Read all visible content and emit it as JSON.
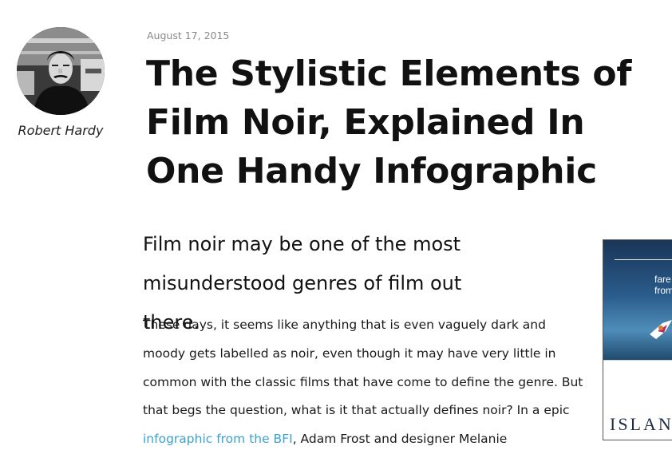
{
  "author": {
    "name": "Robert Hardy"
  },
  "article": {
    "date": "August 17, 2015",
    "title": "The Stylistic Elements of Film Noir, Explained In One Handy Infographic",
    "lead": "Film noir may be one of the most misunderstood genres of film out there.",
    "body_before_link": "These days, it seems like anything that is even vaguely dark and moody gets labelled as noir, even though it may have very little in common with the classic films that have come to define the genre. But that begs the question, what is it that actually defines noir? In a epic ",
    "link_text": "infographic from the BFI",
    "body_after_link": ", Adam Frost and designer Melanie"
  },
  "ad": {
    "copy_line1": "fare",
    "copy_line2": "from",
    "brand": "ISLAN"
  },
  "colors": {
    "link": "#3aa3d0",
    "date": "#888888"
  }
}
